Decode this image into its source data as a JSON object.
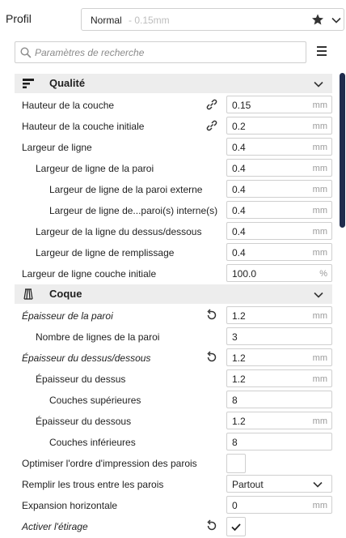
{
  "header": {
    "profile_label": "Profil",
    "profile_name": "Normal",
    "profile_quality": "- 0.15mm"
  },
  "search": {
    "placeholder": "Paramètres de recherche"
  },
  "sections": [
    {
      "title": "Qualité"
    },
    {
      "title": "Coque"
    }
  ],
  "rows": [
    {
      "label": "Hauteur de la couche",
      "value": "0.15",
      "unit": "mm"
    },
    {
      "label": "Hauteur de la couche initiale",
      "value": "0.2",
      "unit": "mm"
    },
    {
      "label": "Largeur de ligne",
      "value": "0.4",
      "unit": "mm"
    },
    {
      "label": "Largeur de ligne de la paroi",
      "value": "0.4",
      "unit": "mm"
    },
    {
      "label": "Largeur de ligne de la paroi externe",
      "value": "0.4",
      "unit": "mm"
    },
    {
      "label": "Largeur de ligne de...paroi(s) interne(s)",
      "value": "0.4",
      "unit": "mm"
    },
    {
      "label": "Largeur de la ligne du dessus/dessous",
      "value": "0.4",
      "unit": "mm"
    },
    {
      "label": "Largeur de ligne de remplissage",
      "value": "0.4",
      "unit": "mm"
    },
    {
      "label": "Largeur de ligne couche initiale",
      "value": "100.0",
      "unit": "%"
    },
    {
      "label": "Épaisseur de la paroi",
      "value": "1.2",
      "unit": "mm"
    },
    {
      "label": "Nombre de lignes de la paroi",
      "value": "3",
      "unit": ""
    },
    {
      "label": "Épaisseur du dessus/dessous",
      "value": "1.2",
      "unit": "mm"
    },
    {
      "label": "Épaisseur du dessus",
      "value": "1.2",
      "unit": "mm"
    },
    {
      "label": "Couches supérieures",
      "value": "8",
      "unit": ""
    },
    {
      "label": "Épaisseur du dessous",
      "value": "1.2",
      "unit": "mm"
    },
    {
      "label": "Couches inférieures",
      "value": "8",
      "unit": ""
    },
    {
      "label": "Optimiser l'ordre d'impression des parois",
      "checked": false
    },
    {
      "label": "Remplir les trous entre les parois",
      "value": "Partout"
    },
    {
      "label": "Expansion horizontale",
      "value": "0",
      "unit": "mm"
    },
    {
      "label": "Activer l'étirage",
      "checked": true
    }
  ]
}
